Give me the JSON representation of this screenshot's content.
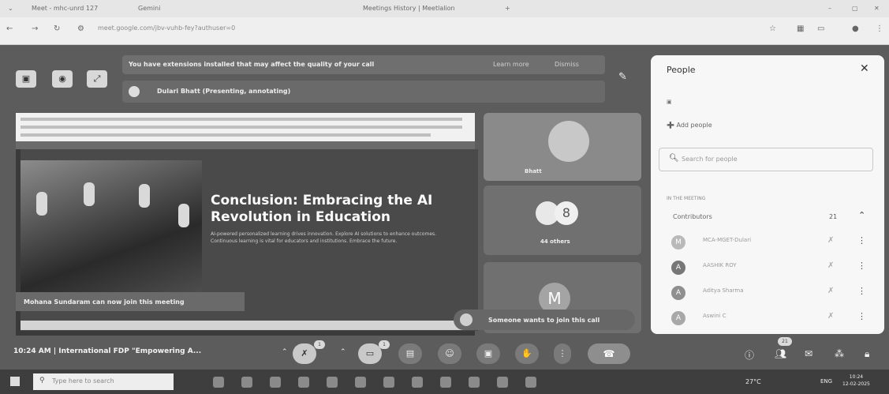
{
  "browser": {
    "tabs": [
      {
        "label": "Meet - mhc-unrd 127"
      },
      {
        "label": "Gemini"
      },
      {
        "label": "Meetings History | Meetlalion"
      }
    ],
    "url": "meet.google.com/jbv-vuhb-fey?authuser=0"
  },
  "banner": {
    "text": "You have extensions installed that may affect the quality of your call",
    "learn_more": "Learn more",
    "dismiss": "Dismiss"
  },
  "presenter": {
    "text": "Dulari Bhatt (Presenting, annotating)"
  },
  "slide": {
    "title": "Conclusion: Embracing the AI Revolution in Education",
    "desc": "AI-powered personalized learning drives innovation. Explore AI solutions to enhance outcomes. Continuous learning is vital for educators and institutions. Embrace the future."
  },
  "toasts": {
    "join_permission": "Mohana Sundaram can now join this meeting",
    "someone_wants": "Someone wants to join this call"
  },
  "tiles": {
    "bhatt_label": "Bhatt",
    "others_label": "44 others",
    "others_count": "8",
    "m_initial": "M"
  },
  "people": {
    "title": "People",
    "add_people": "Add people",
    "search_placeholder": "Search for people",
    "section": "IN THE MEETING",
    "group": "Contributors",
    "group_count": "21",
    "list": [
      {
        "name": "MCA-MGET-Dulari",
        "initial": "M"
      },
      {
        "name": "AASHIK ROY",
        "initial": "A"
      },
      {
        "name": "Aditya Sharma",
        "initial": "A"
      },
      {
        "name": "Aswini C",
        "initial": "A"
      }
    ]
  },
  "controls": {
    "meeting": "10:24 AM  |  International FDP \"Empowering A...",
    "badges": [
      "1",
      "1",
      "21"
    ]
  },
  "taskbar": {
    "search_placeholder": "Type here to search",
    "weather": "27°C",
    "lang": "ENG",
    "time": "10:24",
    "date": "12-02-2025"
  },
  "colors": {
    "panel_bg": "#f7f7f7",
    "meet_bg": "#5c5c5c",
    "taskbar_bg": "#3e3e3e"
  }
}
